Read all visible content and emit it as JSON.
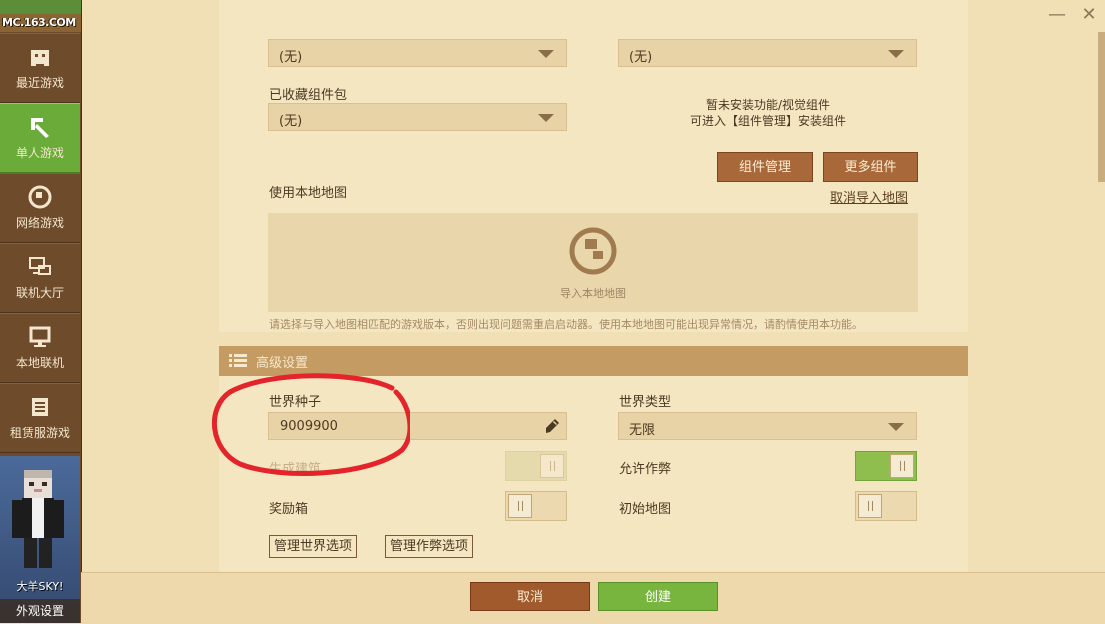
{
  "logo": {
    "text": "MC.163.COM"
  },
  "sidebar": {
    "items": [
      {
        "label": "最近游戏",
        "icon": "gamepad-icon"
      },
      {
        "label": "单人游戏",
        "icon": "pickaxe-icon"
      },
      {
        "label": "网络游戏",
        "icon": "globe-icon"
      },
      {
        "label": "联机大厅",
        "icon": "network-icon"
      },
      {
        "label": "本地联机",
        "icon": "monitor-icon"
      },
      {
        "label": "租赁服游戏",
        "icon": "server-icon"
      }
    ],
    "active_index": 1,
    "user_name": "大羊SKY!",
    "appearance_label": "外观设置"
  },
  "window": {
    "minimize": "—",
    "close": "✕"
  },
  "top": {
    "select_left": "(无)",
    "select_right": "(无)",
    "favorites_label": "已收藏组件包",
    "favorites_value": "(无)",
    "no_components_line1": "暂未安装功能/视觉组件",
    "no_components_line2": "可进入【组件管理】安装组件",
    "manage_components": "组件管理",
    "more_components": "更多组件",
    "local_map_label": "使用本地地图",
    "cancel_import": "取消导入地图",
    "import_map": "导入本地地图",
    "warning": "请选择与导入地图相匹配的游戏版本，否则出现问题需重启启动器。使用本地地图可能出现异常情况，请酌情使用本功能。"
  },
  "advanced": {
    "title": "高级设置",
    "seed_label": "世界种子",
    "seed_value": "9009900",
    "world_type_label": "世界类型",
    "world_type_value": "无限",
    "generate_structures": "生成建筑",
    "generate_structures_on": false,
    "allow_cheats": "允许作弊",
    "allow_cheats_on": true,
    "bonus_chest": "奖励箱",
    "bonus_chest_on": false,
    "start_map": "初始地图",
    "start_map_on": false,
    "manage_world_options": "管理世界选项",
    "manage_cheat_options": "管理作弊选项"
  },
  "footer": {
    "cancel": "取消",
    "create": "创建"
  },
  "colors": {
    "accent_green": "#78b53f",
    "brown_button": "#a9683a",
    "annotation_red": "#e3242b"
  }
}
